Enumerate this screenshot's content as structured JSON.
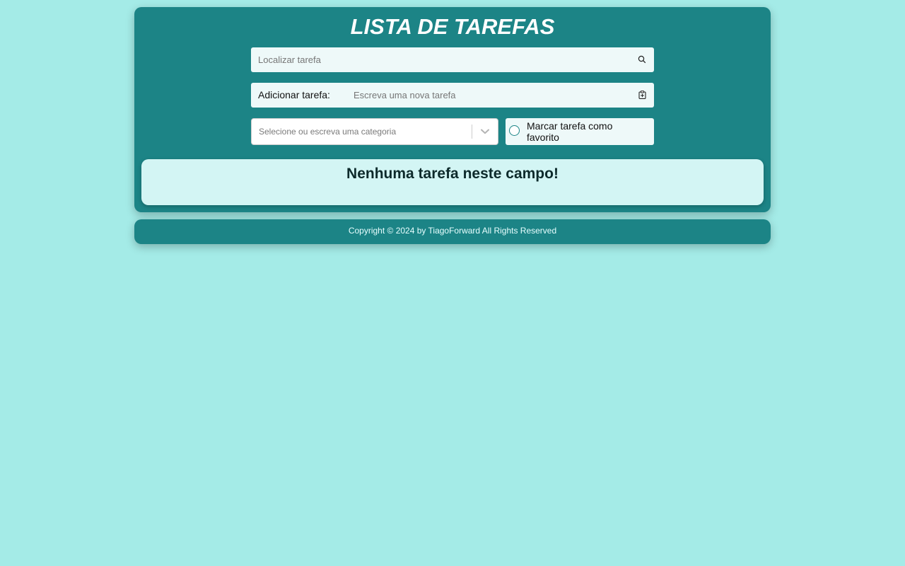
{
  "header": {
    "title": "LISTA DE TAREFAS"
  },
  "search": {
    "placeholder": "Localizar tarefa",
    "icon": "search-icon"
  },
  "add_task": {
    "label": "Adicionar tarefa:",
    "placeholder": "Escreva uma nova tarefa",
    "icon": "clipboard-add-icon"
  },
  "category": {
    "placeholder": "Selecione ou escreva uma categoria",
    "icon": "chevron-down-icon"
  },
  "favorite": {
    "label": "Marcar tarefa como favorito",
    "checked": false
  },
  "task_list": {
    "empty_message": "Nenhuma tarefa neste campo!"
  },
  "footer": {
    "text": "Copyright © 2024 by TiagoForward All Rights Reserved"
  },
  "colors": {
    "page_background": "#a4ebe7",
    "card_background": "#1c8486",
    "input_background": "#eef9f9",
    "panel_background": "#d3f5f4"
  }
}
